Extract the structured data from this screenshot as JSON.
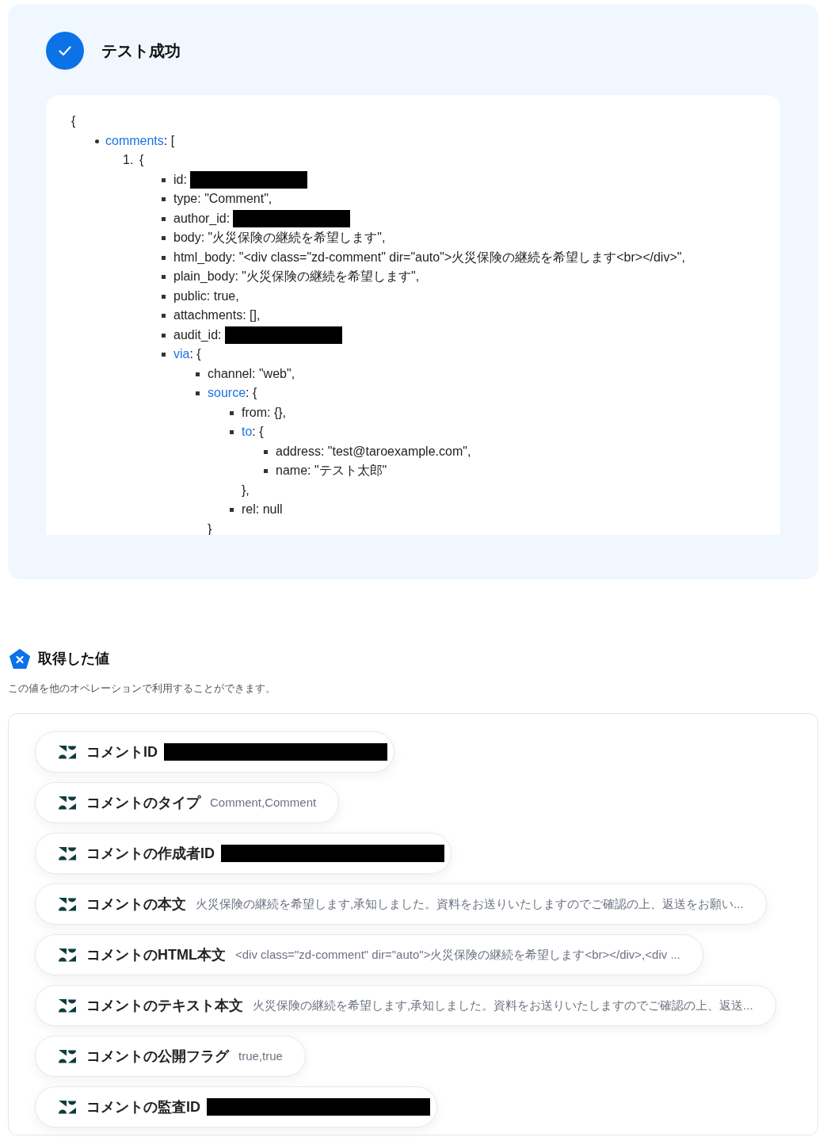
{
  "result": {
    "title": "テスト成功",
    "success": true,
    "code": {
      "open": "{",
      "items": [
        {
          "kind": "key",
          "key": "comments",
          "text": ": [",
          "children": [
            {
              "kind": "numbered",
              "number": "1.",
              "text": "{",
              "children": [
                {
                  "kind": "redacted",
                  "text": "id:"
                },
                {
                  "kind": "plain",
                  "text": "type: \"Comment\","
                },
                {
                  "kind": "redacted",
                  "text": "author_id:"
                },
                {
                  "kind": "plain",
                  "text": "body: \"火災保険の継続を希望します\","
                },
                {
                  "kind": "plain",
                  "text": "html_body: \"<div class=\"zd-comment\" dir=\"auto\">火災保険の継続を希望します<br></div>\","
                },
                {
                  "kind": "plain",
                  "text": "plain_body: \"火災保険の継続を希望します\","
                },
                {
                  "kind": "plain",
                  "text": "public: true,"
                },
                {
                  "kind": "plain",
                  "text": "attachments: [],"
                },
                {
                  "kind": "redacted",
                  "text": "audit_id:"
                },
                {
                  "kind": "key",
                  "key": "via",
                  "text": ": {",
                  "children": [
                    {
                      "kind": "plain",
                      "text": "channel: \"web\","
                    },
                    {
                      "kind": "key",
                      "key": "source",
                      "text": ": {",
                      "children": [
                        {
                          "kind": "plain",
                          "text": "from: {},"
                        },
                        {
                          "kind": "key",
                          "key": "to",
                          "text": ": {",
                          "children": [
                            {
                              "kind": "plain",
                              "text": "address: \"test@taroexample.com\","
                            },
                            {
                              "kind": "plain",
                              "text": "name: \"テスト太郎\""
                            }
                          ]
                        },
                        {
                          "kind": "close",
                          "text": "},"
                        },
                        {
                          "kind": "plain",
                          "text": "rel: null"
                        }
                      ]
                    },
                    {
                      "kind": "close",
                      "text": "}"
                    }
                  ]
                }
              ]
            }
          ]
        }
      ]
    }
  },
  "values": {
    "title": "取得した値",
    "description": "この値を他のオペレーションで利用することができます。",
    "items": [
      {
        "label": "コメントID",
        "redacted": true
      },
      {
        "label": "コメントのタイプ",
        "redacted": false,
        "value": "Comment,Comment"
      },
      {
        "label": "コメントの作成者ID",
        "redacted": true
      },
      {
        "label": "コメントの本文",
        "redacted": false,
        "value": "火災保険の継続を希望します,承知しました。資料をお送りいたしますのでご確認の上、返送をお願い..."
      },
      {
        "label": "コメントのHTML本文",
        "redacted": false,
        "value": "<div class=\"zd-comment\" dir=\"auto\">火災保険の継続を希望します<br></div>,<div ..."
      },
      {
        "label": "コメントのテキスト本文",
        "redacted": false,
        "value": "火災保険の継続を希望します,承知しました。資料をお送りいたしますのでご確認の上、返送..."
      },
      {
        "label": "コメントの公開フラグ",
        "redacted": false,
        "value": "true,true"
      },
      {
        "label": "コメントの監査ID",
        "redacted": true
      }
    ]
  }
}
